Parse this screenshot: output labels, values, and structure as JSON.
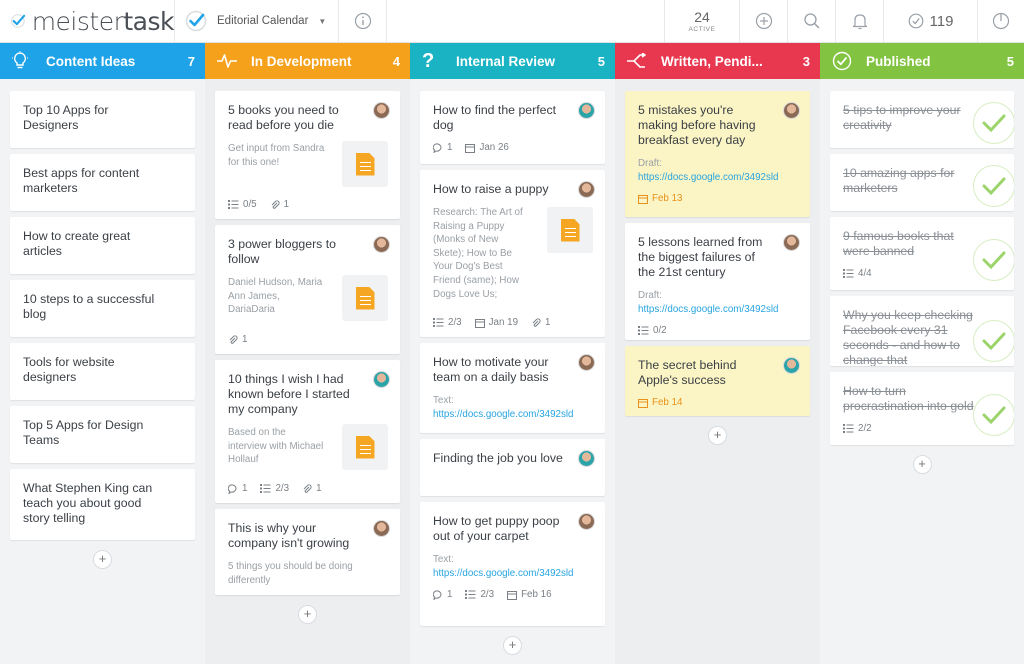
{
  "app": {
    "name_light": "meister",
    "name_bold": "task",
    "project": "Editorial Calendar",
    "active_count": "24",
    "active_label": "ACTIVE",
    "done_count": "119"
  },
  "colors": {
    "content_ideas": "#1fa3e8",
    "in_development": "#f5a11c",
    "internal_review": "#1ab3c3",
    "written_pending": "#e8384f",
    "published": "#82c341",
    "card_yellow": "#fbf4c4",
    "link": "#27a4e0"
  },
  "columns": [
    {
      "title": "Content Ideas",
      "count": "7",
      "icon": "lightbulb-icon",
      "cards": [
        {
          "title": "Top 10 Apps for Designers"
        },
        {
          "title": "Best apps for content marketers"
        },
        {
          "title": "How to create great articles"
        },
        {
          "title": "10 steps to a successful blog"
        },
        {
          "title": "Tools for website designers"
        },
        {
          "title": "Top 5 Apps for Design Teams"
        },
        {
          "title": "What Stephen King can teach you about good story telling"
        }
      ]
    },
    {
      "title": "In Development",
      "count": "4",
      "icon": "pulse-icon",
      "cards": [
        {
          "title": "5 books you need to read before you die",
          "desc": "Get input from Sandra for this one!",
          "checklist": "0/5",
          "attachments": "1"
        },
        {
          "title": "3 power bloggers to follow",
          "desc": "Daniel Hudson, Maria Ann James, DariaDaria",
          "attachments": "1"
        },
        {
          "title": "10 things I wish I had known before I started my company",
          "desc": "Based on the interview with Michael Hollauf",
          "comments": "1",
          "checklist": "2/3",
          "attachments": "1"
        },
        {
          "title": "This is why your company isn't growing",
          "desc": "5 things you should be doing differently"
        }
      ]
    },
    {
      "title": "Internal Review",
      "count": "5",
      "icon": "question-icon",
      "cards": [
        {
          "title": "How to find the perfect dog",
          "comments": "1",
          "date": "Jan 26"
        },
        {
          "title": "How to raise a puppy",
          "desc": "Research: The Art of Raising a Puppy (Monks of New Skete); How to Be Your Dog's Best Friend (same); How Dogs Love Us;",
          "checklist": "2/3",
          "date": "Jan 19",
          "attachments": "1"
        },
        {
          "title": "How to motivate your team on a daily basis",
          "desc": "Text:",
          "link": "https://docs.google.com/3492sld"
        },
        {
          "title": "Finding the job you love"
        },
        {
          "title": "How to get puppy poop out of your carpet",
          "desc": "Text:",
          "link": "https://docs.google.com/3492sld",
          "comments": "1",
          "checklist": "2/3",
          "date": "Feb 16"
        }
      ]
    },
    {
      "title": "Written, Pendi...",
      "count": "3",
      "icon": "split-arrow-icon",
      "cards": [
        {
          "title": "5 mistakes you're making before having breakfast every day",
          "desc": "Draft:",
          "link": "https://docs.google.com/3492sld",
          "date": "Feb 13"
        },
        {
          "title": "5 lessons learned from the biggest failures of the 21st century",
          "desc": "Draft:",
          "link": "https://docs.google.com/3492sld",
          "checklist": "0/2"
        },
        {
          "title": "The secret behind Apple's success",
          "date": "Feb 14"
        }
      ]
    },
    {
      "title": "Published",
      "count": "5",
      "icon": "check-circle-icon",
      "cards": [
        {
          "title": "5 tips to improve your creativity"
        },
        {
          "title": "10 amazing apps for marketers"
        },
        {
          "title": "9 famous books that were banned",
          "checklist": "4/4"
        },
        {
          "title": "Why you keep checking Facebook every 31 seconds - and how to change that"
        },
        {
          "title": "How to turn procrastination into gold",
          "checklist": "2/2"
        }
      ]
    }
  ]
}
